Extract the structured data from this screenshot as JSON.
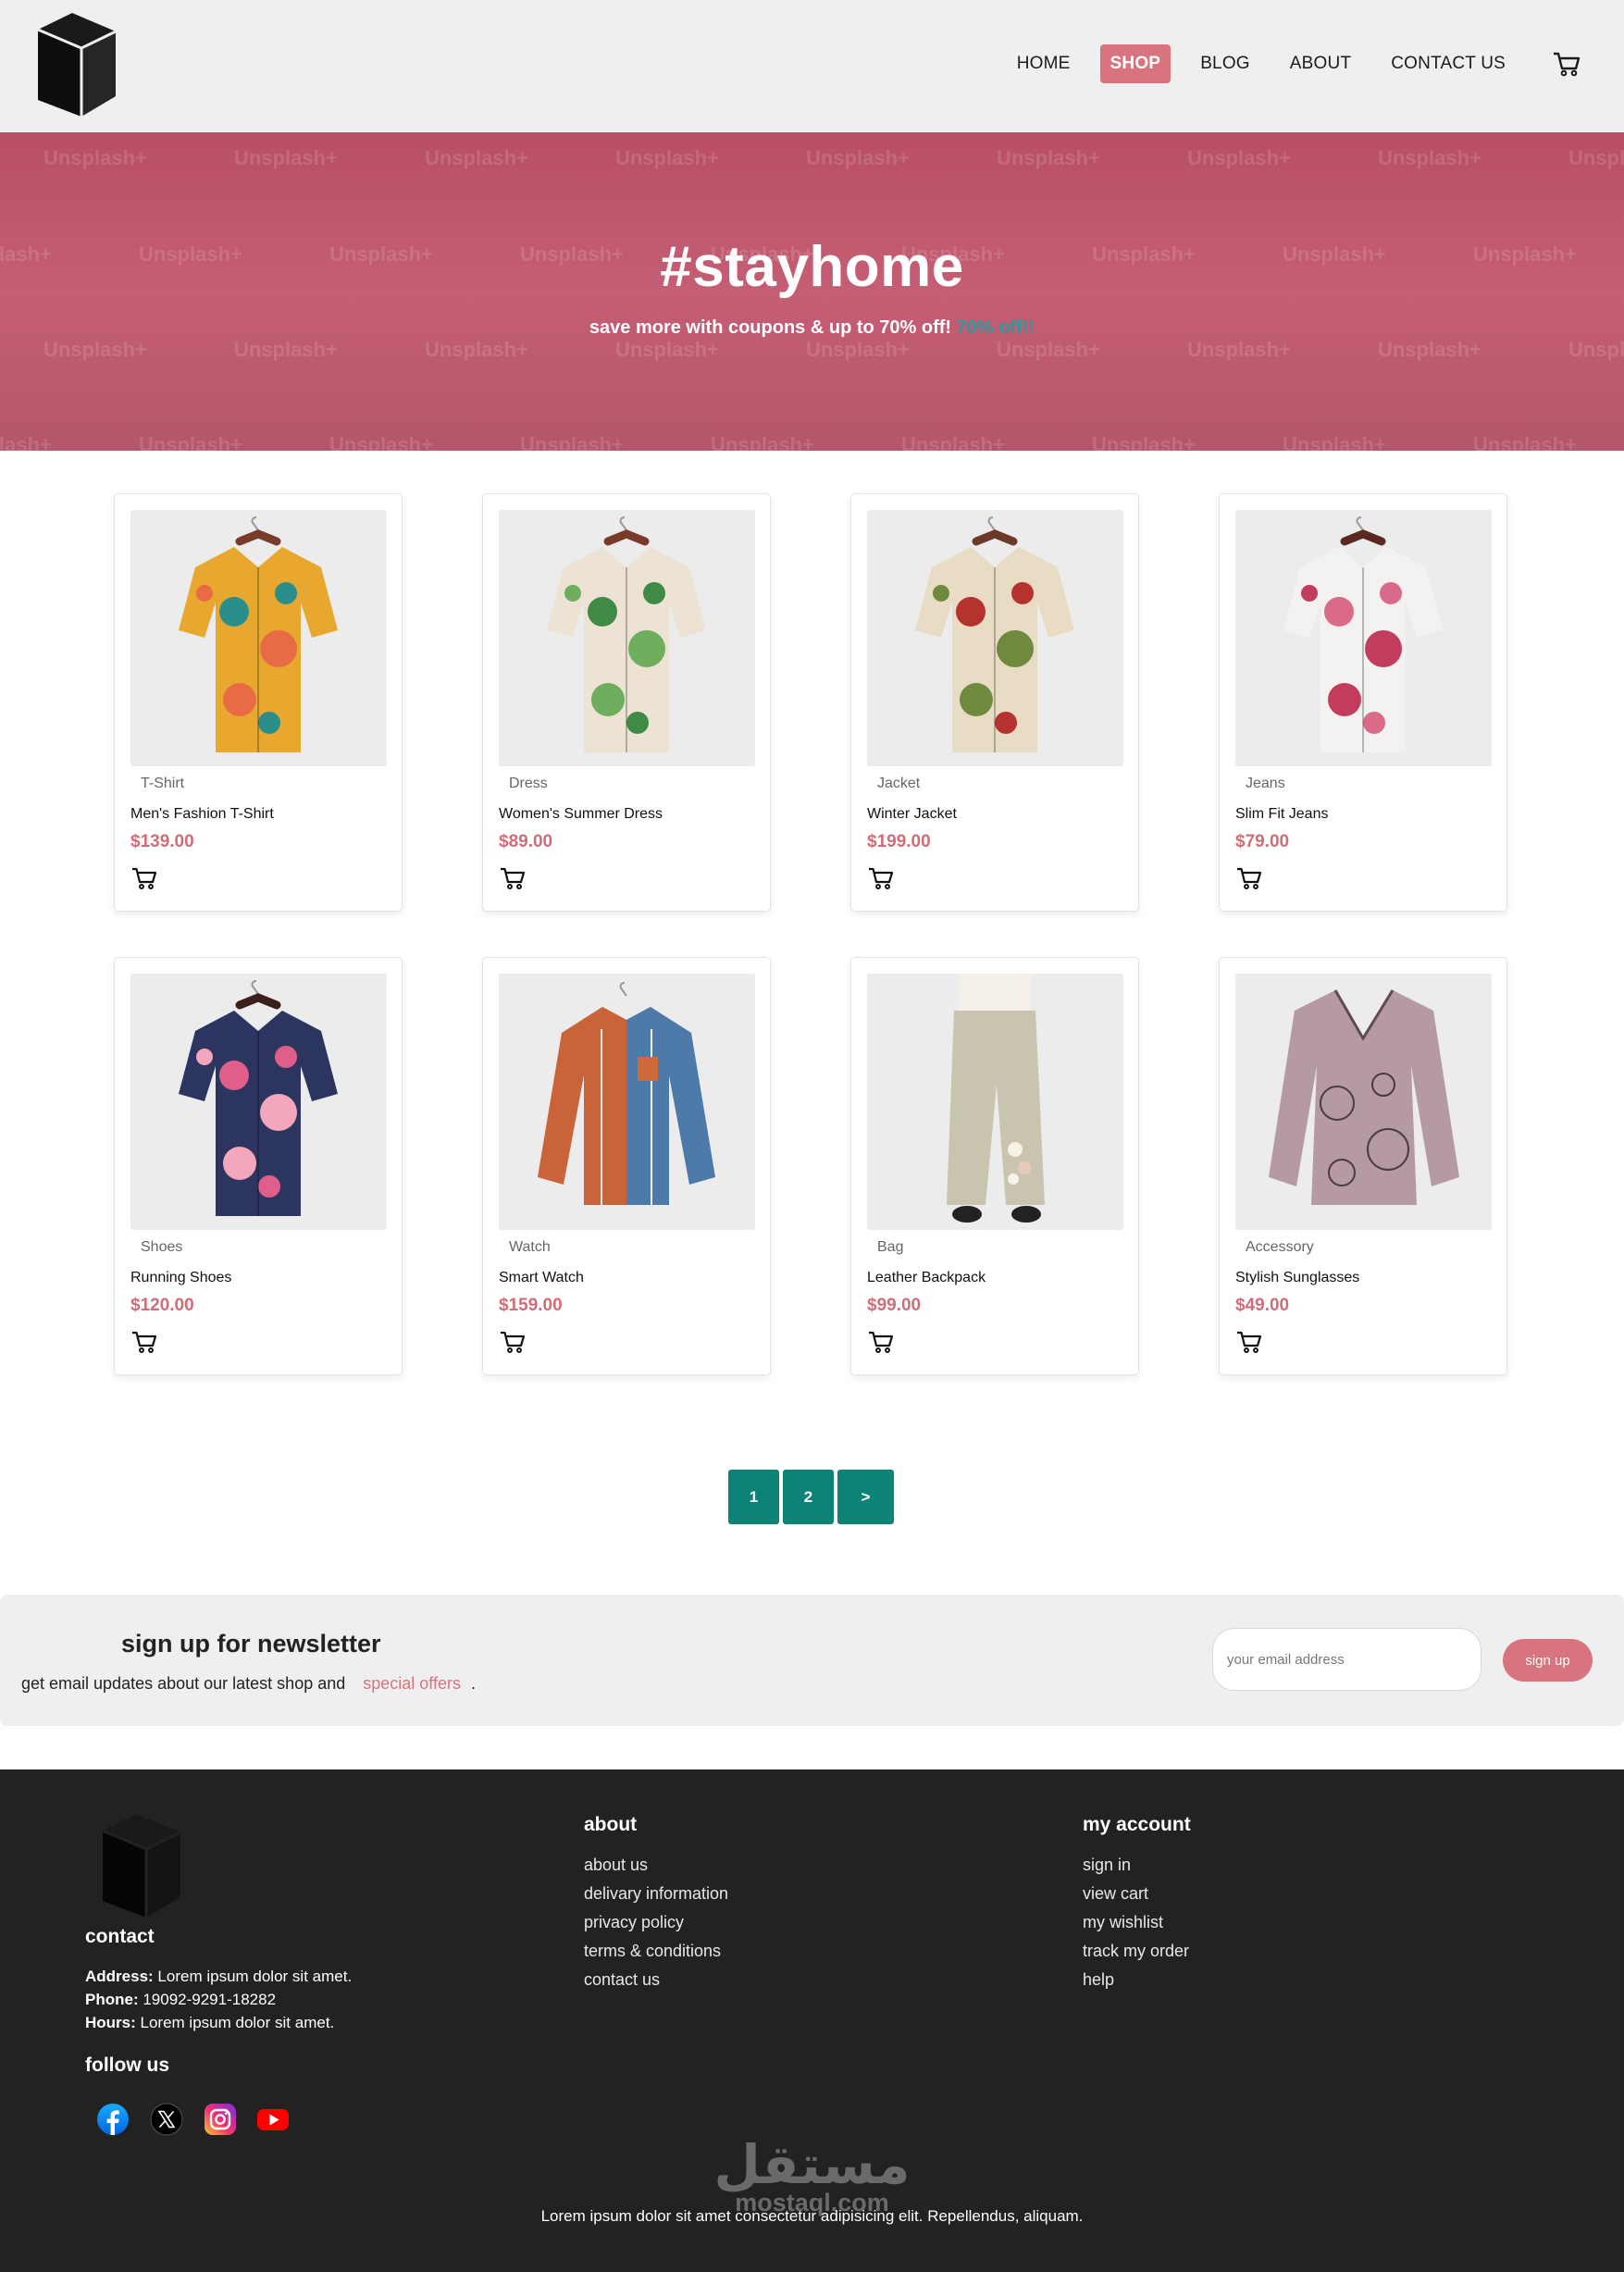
{
  "header": {
    "nav": [
      "HOME",
      "SHOP",
      "BLOG",
      "ABOUT",
      "CONTACT US"
    ],
    "active_nav": "SHOP"
  },
  "hero": {
    "watermark": "Unsplash+",
    "title": "#stayhome",
    "subtitle": "save more with coupons & up to 70% off!",
    "subtitle_highlight": "70% off!!"
  },
  "products": [
    {
      "category": "T-Shirt",
      "name": "Men's Fashion T-Shirt",
      "price": "$139.00"
    },
    {
      "category": "Dress",
      "name": "Women's Summer Dress",
      "price": "$89.00"
    },
    {
      "category": "Jacket",
      "name": "Winter Jacket",
      "price": "$199.00"
    },
    {
      "category": "Jeans",
      "name": "Slim Fit Jeans",
      "price": "$79.00"
    },
    {
      "category": "Shoes",
      "name": "Running Shoes",
      "price": "$120.00"
    },
    {
      "category": "Watch",
      "name": "Smart Watch",
      "price": "$159.00"
    },
    {
      "category": "Bag",
      "name": "Leather Backpack",
      "price": "$99.00"
    },
    {
      "category": "Accessory",
      "name": "Stylish Sunglasses",
      "price": "$49.00"
    }
  ],
  "pagination": [
    "1",
    "2",
    ">"
  ],
  "newsletter": {
    "title": "sign up for newsletter",
    "text": "get email updates about our latest shop and",
    "offers": "special offers",
    "period": ".",
    "placeholder": "your email address",
    "button": "sign up"
  },
  "footer": {
    "contact_title": "contact",
    "address_label": "Address:",
    "address": "Lorem ipsum dolor sit amet.",
    "phone_label": "Phone:",
    "phone": "19092-9291-18282",
    "hours_label": "Hours:",
    "hours": "Lorem ipsum dolor sit amet.",
    "follow_title": "follow us",
    "about_title": "about",
    "about_links": [
      "about us",
      "delivary information",
      "privacy policy",
      "terms & conditions",
      "contact us"
    ],
    "account_title": "my account",
    "account_links": [
      "sign in",
      "view cart",
      "my wishlist",
      "track my order",
      "help"
    ],
    "brand_arabic": "مستقل",
    "brand_latin": "mostaql.com",
    "copyright": "Lorem ipsum dolor sit amet consectetur adipisicing elit. Repellendus, aliquam."
  },
  "colors": {
    "accent": "#d8747d",
    "hero_bg": "#c05a70",
    "pagination": "#0d8277",
    "footer_bg": "#222223",
    "header_bg": "#efefef"
  },
  "icons": {
    "logo": "cube-logo-icon",
    "cart": "shopping-cart-icon",
    "social": [
      "facebook-icon",
      "x-icon",
      "instagram-icon",
      "youtube-icon"
    ]
  }
}
